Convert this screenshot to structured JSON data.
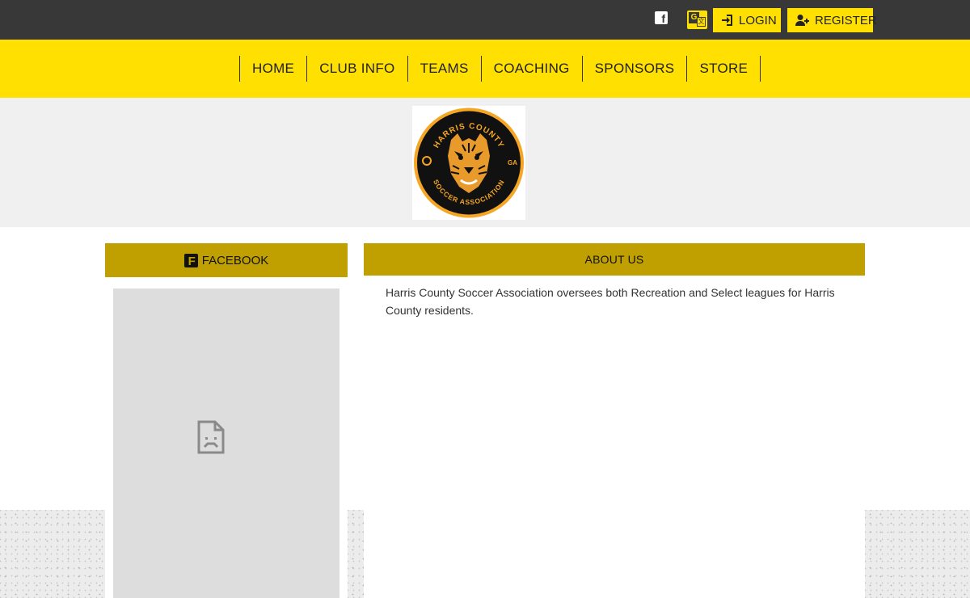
{
  "topbar": {
    "login_label": "LOGIN",
    "register_label": "REGISTER"
  },
  "nav": {
    "items": [
      {
        "label": "HOME"
      },
      {
        "label": "CLUB INFO"
      },
      {
        "label": "TEAMS"
      },
      {
        "label": "COACHING"
      },
      {
        "label": "SPONSORS"
      },
      {
        "label": "STORE"
      }
    ]
  },
  "logo": {
    "ring_text_top": "HARRIS COUNTY",
    "ring_text_bottom": "SOCCER ASSOCIATION",
    "side_right": "GA"
  },
  "facebook": {
    "header_label": "FACEBOOK"
  },
  "about": {
    "header_label": "ABOUT US",
    "text": "Harris County Soccer Association oversees both Recreation and Select leagues for Harris County residents."
  },
  "colors": {
    "topbar": "#383838",
    "accent_yellow": "#FFE000",
    "section_gold": "#C0A000",
    "banner_bg": "#f0f0f0"
  }
}
